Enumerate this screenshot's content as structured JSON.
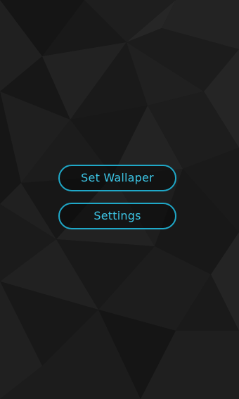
{
  "buttons": {
    "set_wallpaper": "Set Wallaper",
    "settings": "Settings"
  },
  "colors": {
    "accent": "#1fa8c8",
    "text": "#3cc4e4",
    "background": "#1a1a1a"
  }
}
